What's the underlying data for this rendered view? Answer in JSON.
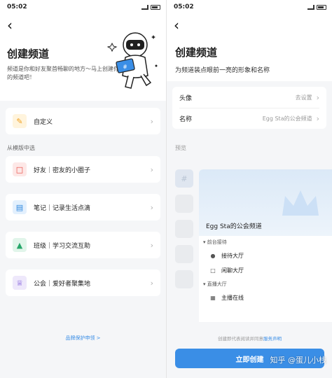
{
  "status_bar": {
    "time": "05:02"
  },
  "left": {
    "title": "创建频道",
    "description": "频道是你和好友聚首畅聊的地方～马上创建你的频道吧！",
    "custom_option": {
      "label": "自定义",
      "icon": "pencil-icon",
      "color": "#f0a020"
    },
    "templates_header": "从模版中选",
    "templates": [
      {
        "label": "好友｜密友的小圈子",
        "icon": "chat-bubble-icon",
        "color": "#e8453c"
      },
      {
        "label": "笔记｜记录生活点滴",
        "icon": "book-icon",
        "color": "#2f88e0"
      },
      {
        "label": "班级｜学习交流互助",
        "icon": "graduation-cap-icon",
        "color": "#27a66a"
      },
      {
        "label": "公会｜爱好者聚集地",
        "icon": "crown-icon",
        "color": "#7b55d9"
      }
    ],
    "footer_link": "品牌保护申领 >"
  },
  "right": {
    "title": "创建频道",
    "subtitle": "为频道装点眼前一亮的形象和名称",
    "avatar_label": "头像",
    "avatar_value": "去设置",
    "name_label": "名称",
    "name_value": "Egg Sta的公会频道",
    "preview_label": "预览",
    "preview": {
      "channel_name": "Egg Sta的公会频道",
      "groups": [
        {
          "name": "前台接待",
          "items": [
            {
              "label": "接待大厅",
              "icon": "microphone-icon"
            },
            {
              "label": "闲聊大厅",
              "icon": "message-icon"
            }
          ]
        },
        {
          "name": "直播大厅",
          "items": [
            {
              "label": "主播在线",
              "icon": "grid-icon"
            }
          ]
        }
      ]
    },
    "agreement_prefix": "创建即代表阅读并同意",
    "agreement_link": "服务声明",
    "create_button": "立即创建"
  },
  "watermark": "知乎 @蛋儿小栈",
  "accent_color": "#3a8ee6"
}
